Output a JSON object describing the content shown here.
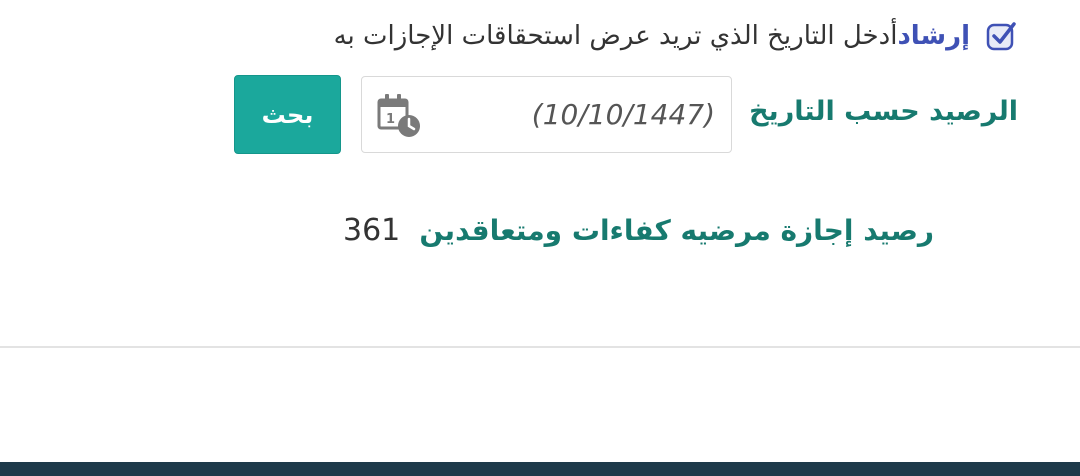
{
  "hint": {
    "icon": "check-square-icon",
    "label": "إرشاد",
    "text": "أدخل التاريخ الذي تريد عرض استحقاقات الإجازات به"
  },
  "form": {
    "label": "الرصيد حسب التاريخ",
    "date_value": "(10/10/1447)",
    "calendar_icon": "calendar-clock-icon",
    "search_label": "بحث"
  },
  "balance": {
    "label": "رصيد إجازة مرضيه كفاءات ومتعاقدين",
    "value": "361"
  },
  "colors": {
    "accent": "#1ba89c",
    "label_green": "#177a6f",
    "hint_blue": "#3f51b5",
    "footer": "#1e3a4a"
  }
}
